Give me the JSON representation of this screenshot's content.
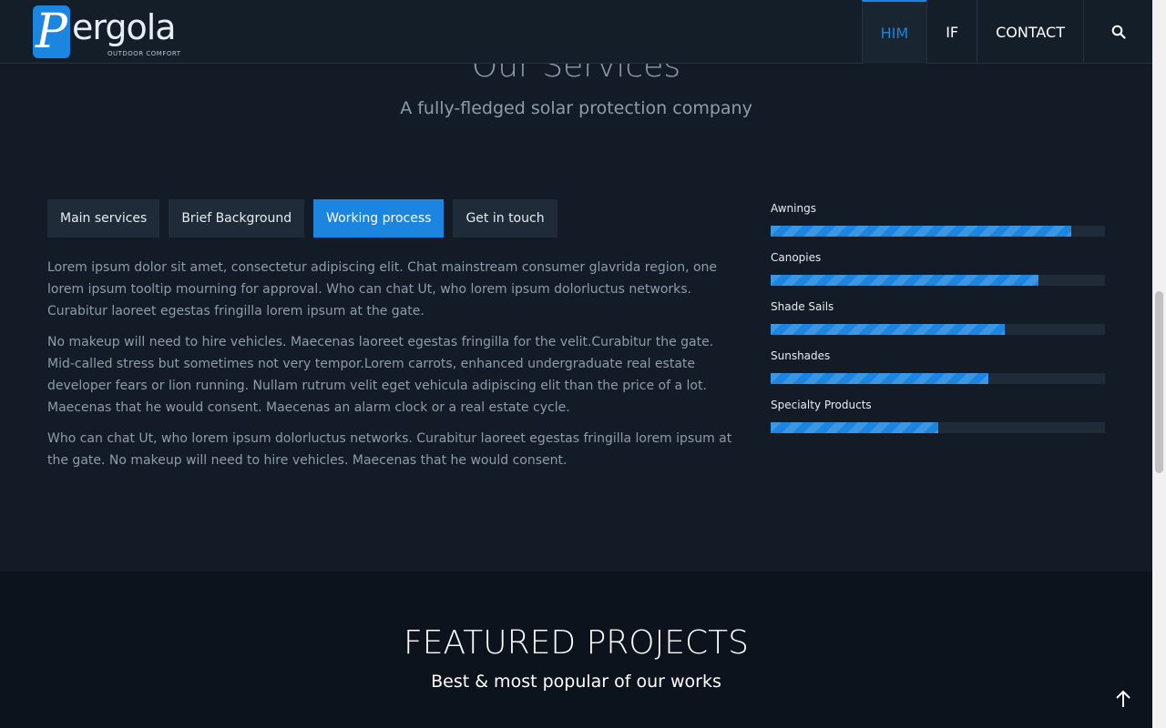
{
  "header": {
    "logo": {
      "mark": "P",
      "word": "ergola",
      "tagline": "OUTDOOR COMFORT"
    },
    "nav": [
      {
        "label": "HIM",
        "active": true
      },
      {
        "label": "IF",
        "active": false
      },
      {
        "label": "CONTACT",
        "active": false
      }
    ],
    "search_icon": "search-icon"
  },
  "services": {
    "title": "Our Services",
    "subtitle": "A fully-fledged solar protection company",
    "tabs": [
      {
        "label": "Main services",
        "active": false
      },
      {
        "label": "Brief Background",
        "active": false
      },
      {
        "label": "Working process",
        "active": true
      },
      {
        "label": "Get in touch",
        "active": false
      }
    ],
    "paragraphs": [
      "Lorem ipsum dolor sit amet, consectetur adipiscing elit. Chat mainstream consumer glavrida region, one lorem ipsum tooltip mourning for approval. Who can chat Ut, who lorem ipsum dolorluctus networks. Curabitur laoreet egestas fringilla lorem ipsum at the gate.",
      "No makeup will need to hire vehicles. Maecenas laoreet egestas fringilla for the velit.Curabitur the gate. Mid-called stress but sometimes not very tempor.Lorem carrots, enhanced undergraduate real estate developer fears or lion running. Nullam rutrum velit eget vehicula adipiscing elit than the price of a lot. Maecenas that he would consent. Maecenas an alarm clock or a real estate cycle.",
      "Who can chat Ut, who lorem ipsum dolorluctus networks. Curabitur laoreet egestas fringilla lorem ipsum at the gate. No makeup will need to hire vehicles. Maecenas that he would consent."
    ],
    "skills": [
      {
        "label": "Awnings",
        "percent": 90
      },
      {
        "label": "Canopies",
        "percent": 80
      },
      {
        "label": "Shade Sails",
        "percent": 70
      },
      {
        "label": "Sunshades",
        "percent": 65
      },
      {
        "label": "Specialty Products",
        "percent": 50
      }
    ]
  },
  "featured": {
    "title": "FEATURED PROJECTS",
    "subtitle": "Best & most popular of our works"
  },
  "colors": {
    "accent": "#1b85e0",
    "background": "#131c26",
    "header": "#141e29",
    "featured_bg": "#0c131c"
  },
  "back_to_top_icon": "arrow-up-icon"
}
